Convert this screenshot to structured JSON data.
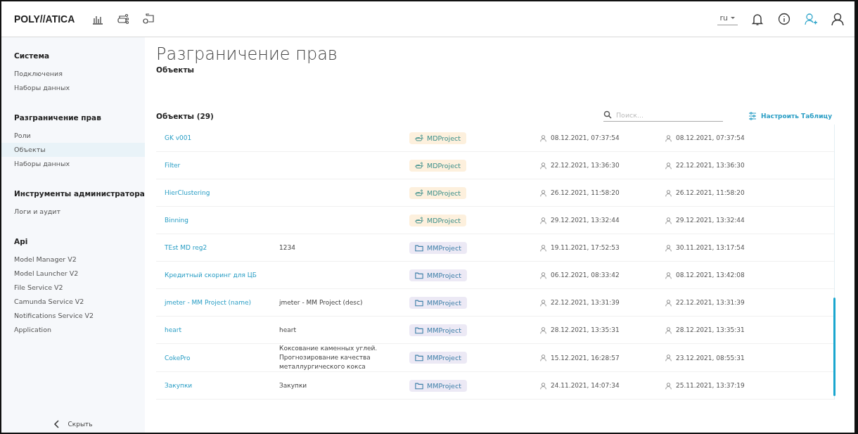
{
  "header": {
    "logo": "POLY//ATICA",
    "language": "ru"
  },
  "sidebar": {
    "sections": [
      {
        "title": "Система",
        "items": [
          {
            "label": "Подключения",
            "selected": false
          },
          {
            "label": "Наборы данных",
            "selected": false
          }
        ]
      },
      {
        "title": "Разграничение прав",
        "items": [
          {
            "label": "Роли",
            "selected": false
          },
          {
            "label": "Объекты",
            "selected": true
          },
          {
            "label": "Наборы данных",
            "selected": false
          }
        ]
      },
      {
        "title": "Инструменты администратора",
        "items": [
          {
            "label": "Логи и аудит",
            "selected": false
          }
        ]
      },
      {
        "title": "Api",
        "items": [
          {
            "label": "Model Manager V2",
            "selected": false
          },
          {
            "label": "Model Launcher V2",
            "selected": false
          },
          {
            "label": "File Service V2",
            "selected": false
          },
          {
            "label": "Camunda Service V2",
            "selected": false
          },
          {
            "label": "Notifications Service V2",
            "selected": false
          },
          {
            "label": "Application",
            "selected": false
          }
        ]
      }
    ],
    "collapse": "Скрыть"
  },
  "page": {
    "title": "Разграничение прав",
    "subtitle": "Объекты"
  },
  "table": {
    "title": "Объекты (29)",
    "search_placeholder": "Поиск...",
    "configure": "Настроить Таблицу",
    "rows": [
      {
        "name": "GK v001",
        "description": "",
        "type": {
          "kind": "md",
          "label": "MDProject"
        },
        "created": "08.12.2021, 07:37:54",
        "modified": "08.12.2021, 07:37:54"
      },
      {
        "name": "Filter",
        "description": "",
        "type": {
          "kind": "md",
          "label": "MDProject"
        },
        "created": "22.12.2021, 13:36:30",
        "modified": "22.12.2021, 13:36:30"
      },
      {
        "name": "HierClustering",
        "description": "",
        "type": {
          "kind": "md",
          "label": "MDProject"
        },
        "created": "26.12.2021, 11:58:20",
        "modified": "26.12.2021, 11:58:20"
      },
      {
        "name": "Binning",
        "description": "",
        "type": {
          "kind": "md",
          "label": "MDProject"
        },
        "created": "29.12.2021, 13:32:44",
        "modified": "29.12.2021, 13:32:44"
      },
      {
        "name": "TEst MD reg2",
        "description": "1234",
        "type": {
          "kind": "mm",
          "label": "MMProject"
        },
        "created": "19.11.2021, 17:52:53",
        "modified": "30.11.2021, 13:17:54"
      },
      {
        "name": "Кредитный скоринг для ЦБ",
        "description": "",
        "type": {
          "kind": "mm",
          "label": "MMProject"
        },
        "created": "06.12.2021, 08:33:42",
        "modified": "08.12.2021, 13:42:08"
      },
      {
        "name": "jmeter - MM Project (name)",
        "description": "jmeter - MM Project (desc)",
        "type": {
          "kind": "mm",
          "label": "MMProject"
        },
        "created": "22.12.2021, 13:31:39",
        "modified": "22.12.2021, 13:31:39"
      },
      {
        "name": "heart",
        "description": "heart",
        "type": {
          "kind": "mm",
          "label": "MMProject"
        },
        "created": "28.12.2021, 13:35:31",
        "modified": "28.12.2021, 13:35:31"
      },
      {
        "name": "CokePro",
        "description": "Коксование каменных углей. Прогнозирование качества металлургического кокса",
        "type": {
          "kind": "mm",
          "label": "MMProject"
        },
        "created": "15.12.2021, 16:28:57",
        "modified": "23.12.2021, 08:55:31"
      },
      {
        "name": "Закупки",
        "description": "Закупки",
        "type": {
          "kind": "mm",
          "label": "MMProject"
        },
        "created": "24.11.2021, 14:07:34",
        "modified": "25.11.2021, 13:37:19"
      }
    ]
  }
}
